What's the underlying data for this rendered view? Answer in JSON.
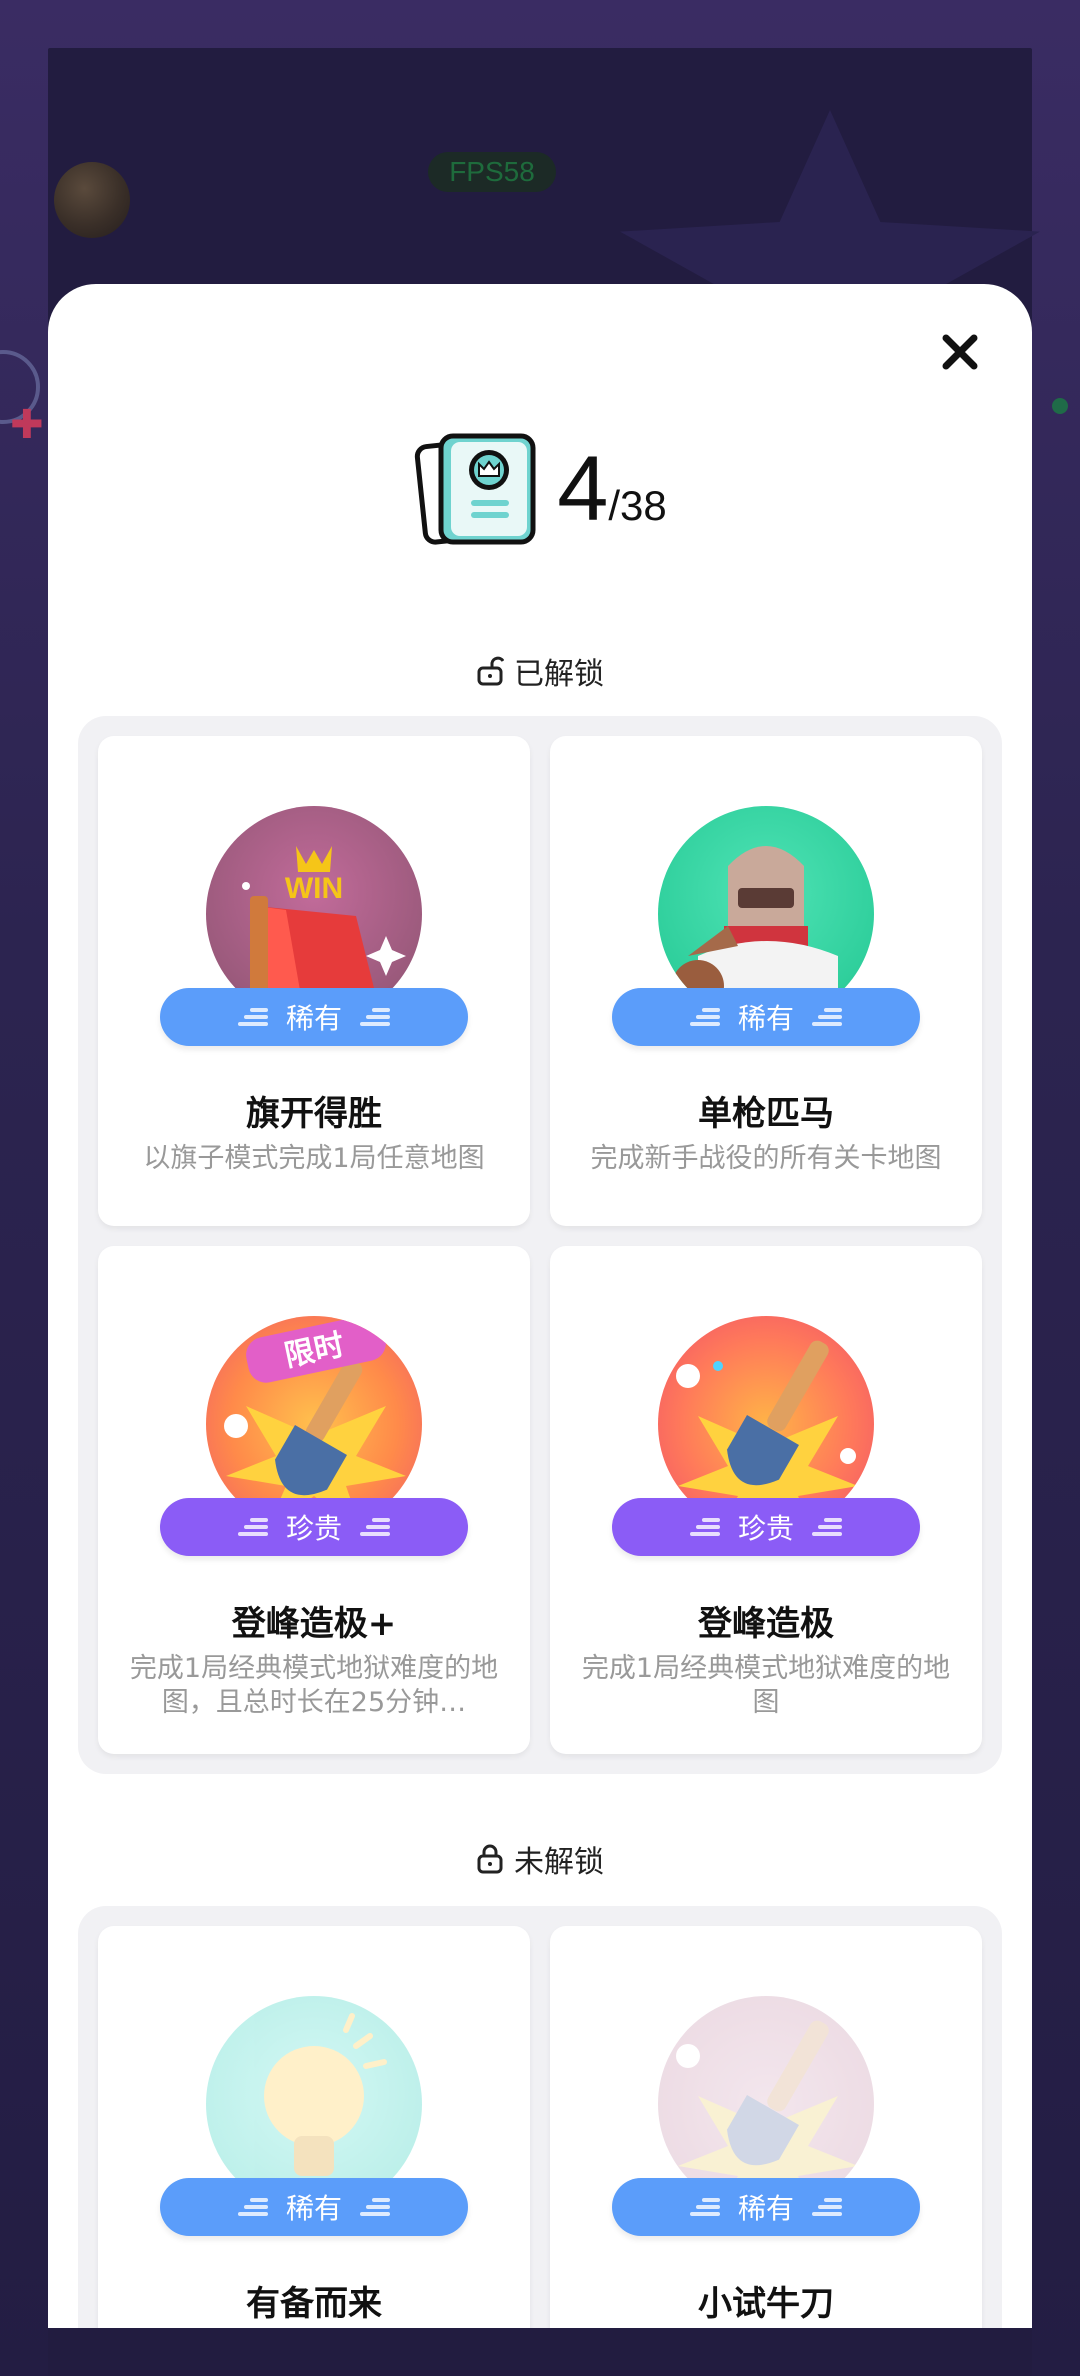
{
  "background": {
    "fps_label": "FPS58"
  },
  "modal": {
    "counter": {
      "unlocked": "4",
      "total": "/38"
    },
    "unlocked_section": {
      "title": "已解锁",
      "cards": [
        {
          "title": "旗开得胜",
          "desc": "以旗子模式完成1局任意地图",
          "rarity": "稀有",
          "rarity_color": "#5b9dfa",
          "badge_text": "WIN"
        },
        {
          "title": "单枪匹马",
          "desc": "完成新手战役的所有关卡地图",
          "rarity": "稀有",
          "rarity_color": "#5b9dfa"
        },
        {
          "title": "登峰造极+",
          "desc": "完成1局经典模式地狱难度的地图，且总时长在25分钟…",
          "rarity": "珍贵",
          "rarity_color": "#8b5cf6",
          "badge_text": "限时"
        },
        {
          "title": "登峰造极",
          "desc": "完成1局经典模式地狱难度的地图",
          "rarity": "珍贵",
          "rarity_color": "#8b5cf6"
        }
      ]
    },
    "locked_section": {
      "title": "未解锁",
      "cards": [
        {
          "title": "有备而来",
          "rarity": "稀有",
          "rarity_color": "#5b9dfa"
        },
        {
          "title": "小试牛刀",
          "rarity": "稀有",
          "rarity_color": "#5b9dfa"
        }
      ]
    }
  },
  "icons": {
    "close": "close-icon",
    "collection": "achievement-book-icon",
    "unlocked": "unlocked-padlock-icon",
    "locked": "locked-padlock-icon"
  }
}
